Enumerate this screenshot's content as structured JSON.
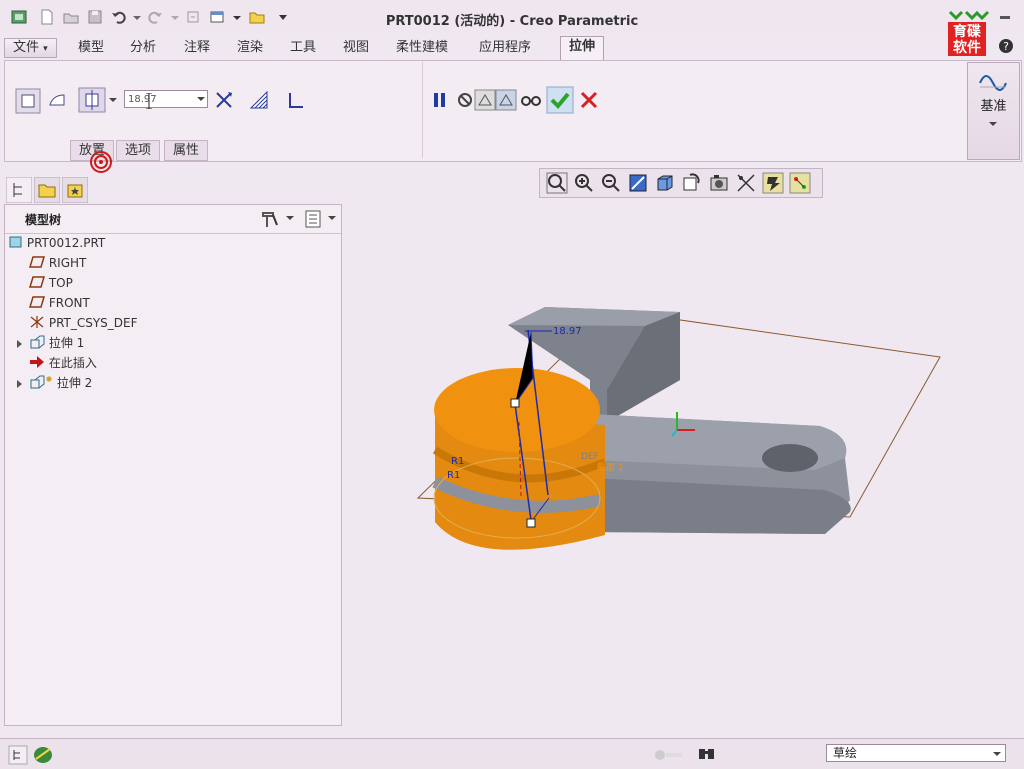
{
  "window": {
    "title": "PRT0012 (活动的) - Creo Parametric"
  },
  "logo": {
    "line1": "育碟",
    "line2": "软件"
  },
  "tabs": [
    "文件",
    "模型",
    "分析",
    "注释",
    "渲染",
    "工具",
    "视图",
    "柔性建模",
    "应用程序",
    "拉伸"
  ],
  "active_tab": "拉伸",
  "ribbon": {
    "depth_value": "18.97",
    "subtabs": [
      "放置",
      "选项",
      "属性"
    ],
    "datum_label": "基准"
  },
  "model_tree": {
    "title": "模型树",
    "items": [
      {
        "label": "PRT0012.PRT",
        "icon": "part-icon"
      },
      {
        "label": "RIGHT",
        "icon": "datum-plane-icon"
      },
      {
        "label": "TOP",
        "icon": "datum-plane-icon"
      },
      {
        "label": "FRONT",
        "icon": "datum-plane-icon"
      },
      {
        "label": "PRT_CSYS_DEF",
        "icon": "csys-icon"
      },
      {
        "label": "拉伸 1",
        "icon": "extrude-icon"
      },
      {
        "label": "在此插入",
        "icon": "insert-here-icon"
      },
      {
        "label": "拉伸 2",
        "icon": "extrude-new-icon"
      }
    ]
  },
  "viewport": {
    "dimension": "18.97",
    "radius_label_1": "R1",
    "radius_label_2": "R1",
    "csys_label": "DEF",
    "section_label": "截面 1"
  },
  "status": {
    "filter_value": "草绘"
  },
  "colors": {
    "feature_orange": "#f0900f",
    "part_gray": "#8c909a",
    "accept_green": "#2aa52a",
    "cancel_red": "#d42020",
    "dimension_blue": "#1a2bb0"
  }
}
